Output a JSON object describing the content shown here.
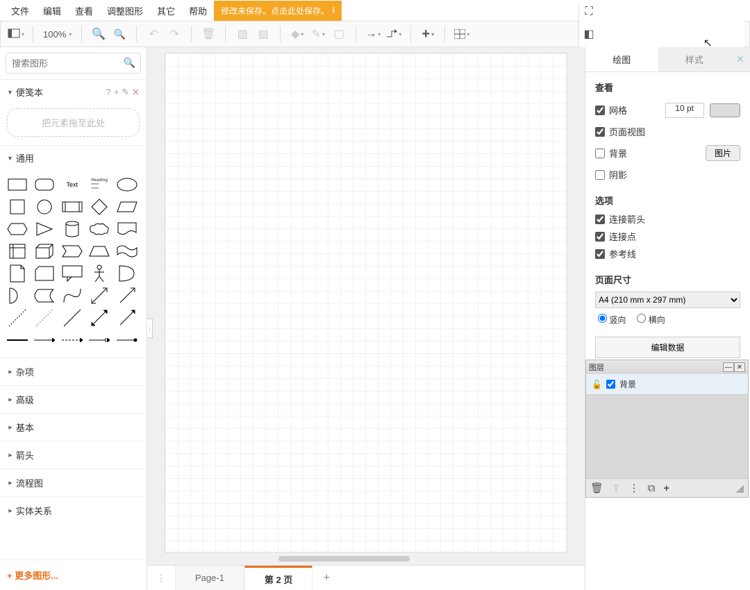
{
  "menu": {
    "items": [
      "文件",
      "编辑",
      "查看",
      "调整图形",
      "其它",
      "帮助"
    ]
  },
  "save_banner": "修改未保存。点击此处保存。",
  "toolbar": {
    "zoom": "100%"
  },
  "left": {
    "search_placeholder": "搜索图形",
    "scratchpad": {
      "title": "便笺本",
      "hint": "把元素拖至此处"
    },
    "general_title": "通用",
    "shape_text": "Text",
    "shape_heading": "Heading",
    "categories": [
      "杂项",
      "高级",
      "基本",
      "箭头",
      "流程图",
      "实体关系"
    ],
    "more": "+ 更多图形..."
  },
  "tabs": {
    "page1": "Page-1",
    "page2": "第 2 页"
  },
  "right": {
    "tab_draw": "绘图",
    "tab_style": "样式",
    "view_title": "查看",
    "grid": "网格",
    "grid_value": "10 pt",
    "page_view": "页面视图",
    "background": "背景",
    "image_btn": "图片",
    "shadow": "阴影",
    "options_title": "选项",
    "conn_arrows": "连接箭头",
    "conn_points": "连接点",
    "guides": "参考线",
    "page_size_title": "页面尺寸",
    "page_size_value": "A4 (210 mm x 297 mm)",
    "portrait": "竖向",
    "landscape": "横向",
    "edit_data": "编辑数据"
  },
  "layers": {
    "title": "图层",
    "bg": "背景"
  }
}
